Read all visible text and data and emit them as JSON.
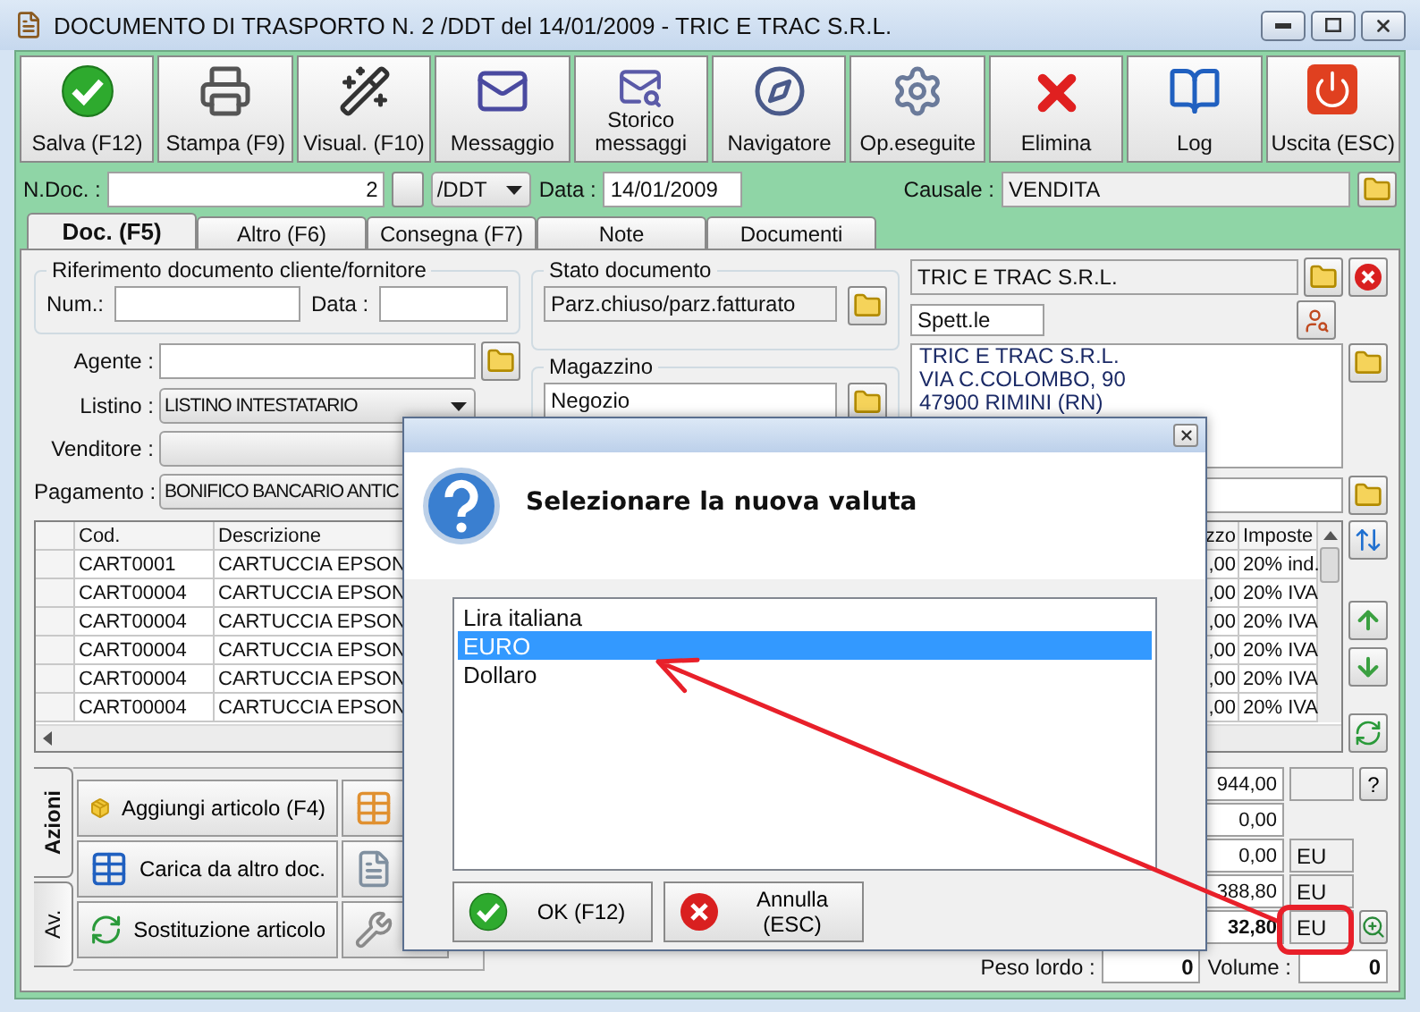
{
  "window": {
    "title": "DOCUMENTO DI TRASPORTO N. 2 /DDT del 14/01/2009 - TRIC E TRAC S.R.L."
  },
  "toolbar": [
    "Salva (F12)",
    "Stampa (F9)",
    "Visual. (F10)",
    "Messaggio",
    "Storico messaggi",
    "Navigatore",
    "Op.eseguite",
    "Elimina",
    "Log",
    "Uscita (ESC)"
  ],
  "doc_header": {
    "number_label": "N.Doc. :",
    "number": "2",
    "series": "/DDT",
    "date_label": "Data :",
    "date": "14/01/2009",
    "causale_label": "Causale :",
    "causale": "VENDITA"
  },
  "tabs": [
    {
      "label": "Doc. (F5)",
      "selected": true
    },
    {
      "label": "Altro (F6)",
      "selected": false
    },
    {
      "label": "Consegna (F7)",
      "selected": false
    },
    {
      "label": "Note",
      "selected": false
    },
    {
      "label": "Documenti",
      "selected": false
    }
  ],
  "reference": {
    "title": "Riferimento documento cliente/fornitore",
    "num_label": "Num.:",
    "date_label": "Data :"
  },
  "fields": [
    {
      "label": "Agente :",
      "kind": "input"
    },
    {
      "label": "Listino :",
      "kind": "select",
      "value": "LISTINO INTESTATARIO"
    },
    {
      "label": "Venditore :",
      "kind": "select"
    },
    {
      "label": "Pagamento :",
      "kind": "select",
      "value": "BONIFICO BANCARIO ANTIC"
    }
  ],
  "status": {
    "title": "Stato documento",
    "value": "Parz.chiuso/parz.fatturato"
  },
  "warehouse": {
    "title": "Magazzino",
    "value": "Negozio"
  },
  "customer": {
    "name": "TRIC E TRAC S.R.L.",
    "salutation": "Spett.le",
    "address": [
      "TRIC E TRAC S.R.L.",
      "VIA C.COLOMBO, 90",
      "47900 RIMINI (RN)"
    ]
  },
  "table": {
    "columns": [
      "Cod.",
      "Descrizione",
      "zzo",
      "Imposte"
    ],
    "rows": [
      [
        "CART0001",
        "CARTUCCIA EPSON",
        ",00",
        "20% ind."
      ],
      [
        "CART00004",
        "CARTUCCIA EPSON",
        ",00",
        "20% IVA"
      ],
      [
        "CART00004",
        "CARTUCCIA EPSON",
        ",00",
        "20% IVA"
      ],
      [
        "CART00004",
        "CARTUCCIA EPSON",
        ",00",
        "20% IVA"
      ],
      [
        "CART00004",
        "CARTUCCIA EPSON",
        ",00",
        "20% IVA"
      ],
      [
        "CART00004",
        "CARTUCCIA EPSON",
        ",00",
        "20% IVA"
      ]
    ]
  },
  "side_tabs": [
    {
      "label": "Azioni",
      "selected": true
    },
    {
      "label": "Av.",
      "selected": false
    }
  ],
  "actions": [
    "Aggiungi articolo (F4)",
    "Carica da altro doc.",
    "Sostituzione articolo"
  ],
  "totals": [
    {
      "kind": "help",
      "value": "944,00",
      "button": "?"
    },
    {
      "kind": "plain",
      "value": "0,00"
    },
    {
      "kind": "currency",
      "value": "0,00",
      "currency": "EU"
    },
    {
      "kind": "currency",
      "value": "388,80",
      "currency": "EU"
    },
    {
      "kind": "total",
      "value": "32,80",
      "currency": "EU"
    }
  ],
  "weights": {
    "gross_label": "Peso lordo :",
    "gross": "0",
    "volume_label": "Volume :",
    "volume": "0"
  },
  "dialog": {
    "heading": "Selezionare la nuova valuta",
    "options": [
      {
        "label": "Lira italiana",
        "selected": false
      },
      {
        "label": "EURO",
        "selected": true
      },
      {
        "label": "Dollaro",
        "selected": false
      }
    ],
    "buttons": [
      "OK (F12)",
      "Annulla (ESC)"
    ]
  }
}
